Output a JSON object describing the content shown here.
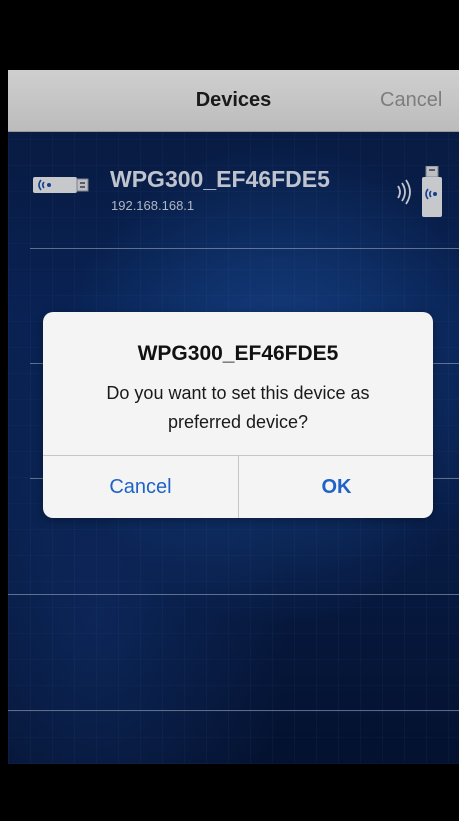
{
  "navbar": {
    "title": "Devices",
    "cancel_label": "Cancel"
  },
  "device": {
    "name": "WPG300_EF46FDE5",
    "ip": "192.168.168.1",
    "left_icon": "wireless-dongle-icon",
    "right_icon": "usb-wireless-signal-icon"
  },
  "alert": {
    "title": "WPG300_EF46FDE5",
    "message": "Do you want to set this device as preferred device?",
    "cancel_label": "Cancel",
    "ok_label": "OK"
  },
  "colors": {
    "nav_bar": "#c4c4c4",
    "alert_button": "#1f63c6",
    "background": "#0b2a66"
  }
}
